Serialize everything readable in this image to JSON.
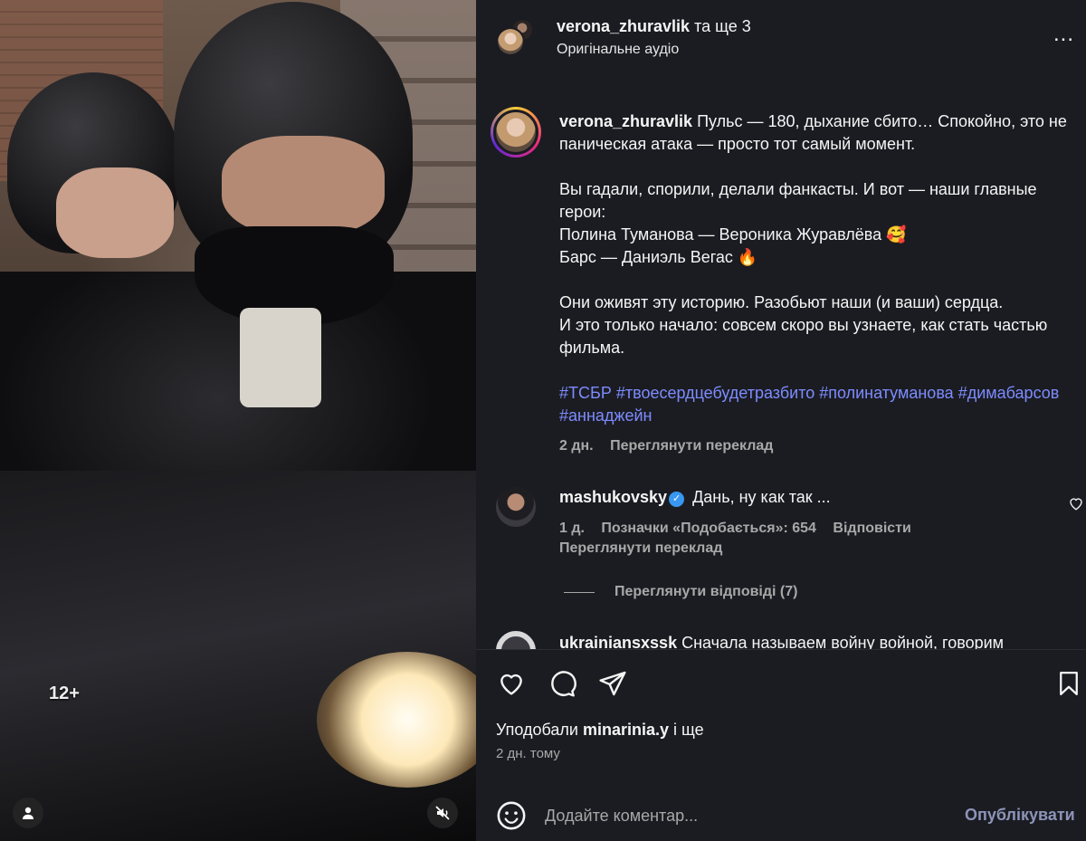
{
  "media": {
    "age_badge": "12+"
  },
  "header": {
    "username": "verona_zhuravlik",
    "others": " та ще 3",
    "audio": "Оригінальне аудіо",
    "more_label": "..."
  },
  "caption": {
    "username": "verona_zhuravlik",
    "text": " Пульс — 180, дыхание сбито… Спокойно, это не паническая атака — просто тот самый момент.\n\nВы гадали, спорили, делали фанкасты. И вот — наши главные герои:\nПолина Туманова — Вероника Журавлёва 🥰\nБарс — Даниэль Вегас 🔥\n\nОни оживят эту историю. Разобьют наши (и ваши) сердца.\nИ это только начало: совсем скоро вы узнаете, как стать частью фильма.\n\n",
    "hashtags": "#ТСБР #твоесердцебудетразбито #полинатуманова #димабарсов #аннаджейн",
    "time": "2 дн.",
    "translate": "Переглянути переклад"
  },
  "comments": [
    {
      "username": "mashukovsky",
      "text": " Дань, ну как так ...",
      "time": "1 д.",
      "likes": "Позначки «Подобається»: 654",
      "reply": "Відповісти",
      "translate": "Переглянути переклад",
      "view_replies": "Переглянути відповіді (7)"
    },
    {
      "username": "ukrainiansxssk",
      "text": " Сначала называем войну войной, говорим"
    }
  ],
  "actions": {
    "liked_by_prefix": "Уподобали ",
    "liked_by_user": "minarinia.y",
    "liked_by_suffix": " і ще",
    "posted": "2 дн. тому"
  },
  "comment_box": {
    "placeholder": "Додайте коментар...",
    "publish": "Опублікувати"
  },
  "colors": {
    "panel_bg": "#1b1c22",
    "hashtag": "#7d8cff",
    "muted": "#a8a8a8",
    "verified": "#3897f0"
  }
}
